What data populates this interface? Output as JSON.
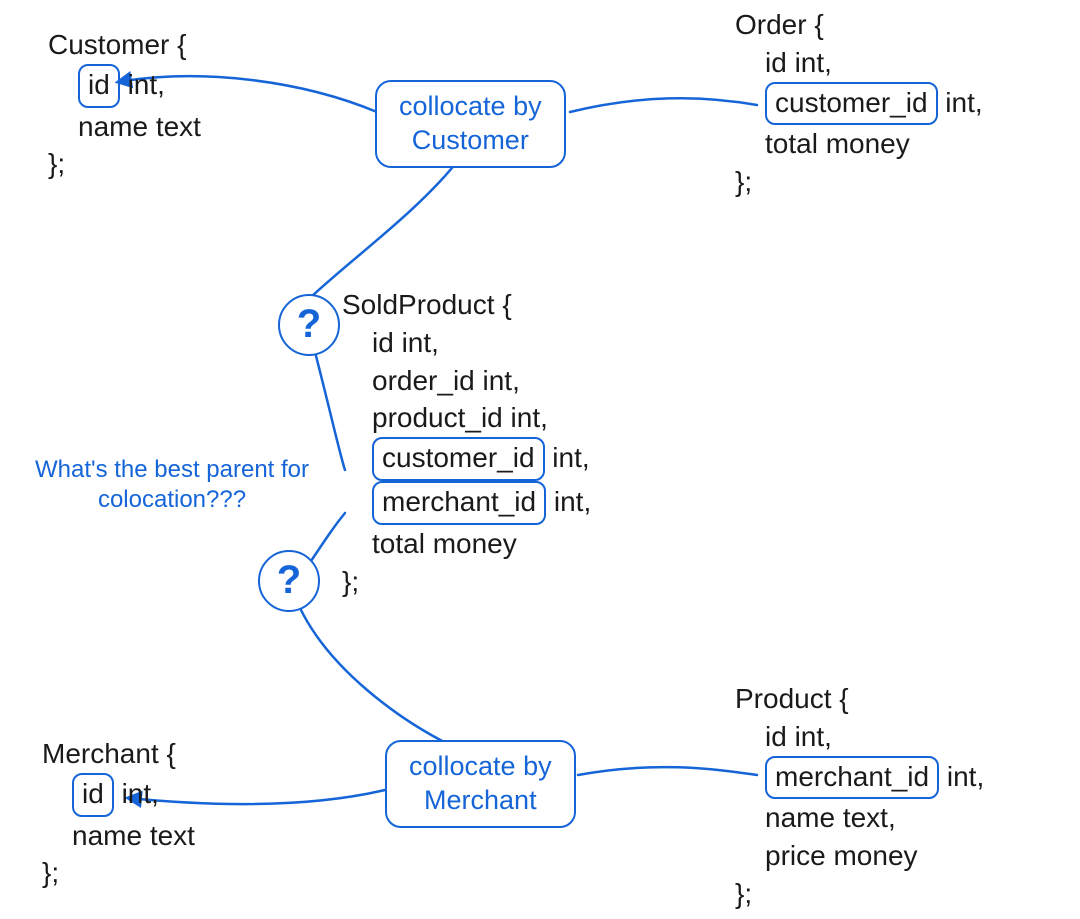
{
  "entities": {
    "customer": {
      "title": "Customer {",
      "field_id": "id",
      "field_id_type": " int,",
      "field_name": "name text",
      "close": "};"
    },
    "order": {
      "title": "Order {",
      "field_id": "id int,",
      "field_cust": "customer_id",
      "field_cust_type": " int,",
      "field_total": "total money",
      "close": "};"
    },
    "soldproduct": {
      "title": "SoldProduct {",
      "f1": "id int,",
      "f2": "order_id int,",
      "f3": "product_id int,",
      "f4": "customer_id",
      "f4_type": " int,",
      "f5": "merchant_id",
      "f5_type": " int,",
      "f6": "total money",
      "close": "};"
    },
    "merchant": {
      "title": "Merchant {",
      "field_id": "id",
      "field_id_type": " int,",
      "field_name": "name text",
      "close": "};"
    },
    "product": {
      "title": "Product {",
      "f1": "id int,",
      "f2": "merchant_id",
      "f2_type": " int,",
      "f3": "name text,",
      "f4": "price money",
      "close": "};"
    }
  },
  "labels": {
    "collocate_customer_l1": "collocate by",
    "collocate_customer_l2": "Customer",
    "collocate_merchant_l1": "collocate by",
    "collocate_merchant_l2": "Merchant",
    "question_mark": "?",
    "aside_l1": "What's the best parent for",
    "aside_l2": "colocation???"
  },
  "colors": {
    "ink": "#1a1a1a",
    "blue": "#1565d8"
  }
}
